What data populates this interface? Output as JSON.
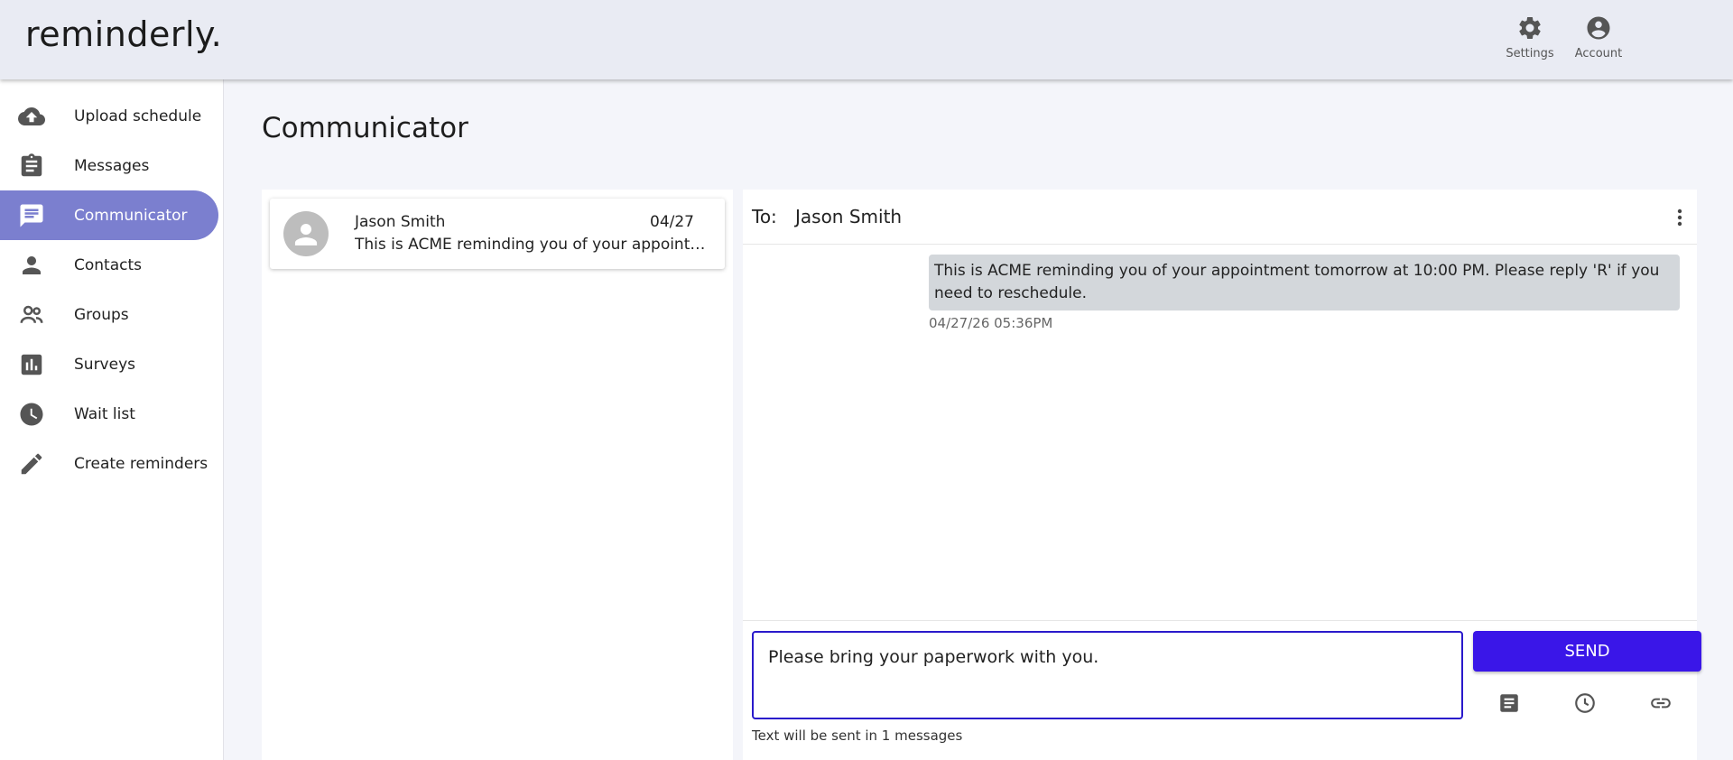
{
  "app": {
    "logo": "reminderly."
  },
  "header": {
    "settings_label": "Settings",
    "account_label": "Account"
  },
  "sidebar": {
    "items": [
      {
        "label": "Upload schedule",
        "icon": "cloud-upload-icon"
      },
      {
        "label": "Messages",
        "icon": "clipboard-icon"
      },
      {
        "label": "Communicator",
        "icon": "chat-icon",
        "active": true
      },
      {
        "label": "Contacts",
        "icon": "person-icon"
      },
      {
        "label": "Groups",
        "icon": "people-icon"
      },
      {
        "label": "Surveys",
        "icon": "bar-chart-icon"
      },
      {
        "label": "Wait list",
        "icon": "clock-icon"
      },
      {
        "label": "Create reminders",
        "icon": "pencil-icon"
      }
    ]
  },
  "page": {
    "title": "Communicator"
  },
  "conversations": [
    {
      "name": "Jason Smith",
      "date": "04/27",
      "preview": "This is ACME reminding you of your appointment tomorrow at 10:00 PM. Please reply 'R' if you need to reschedule."
    }
  ],
  "thread": {
    "to_label": "To:",
    "to_name": "Jason Smith",
    "messages": [
      {
        "text": "This is ACME reminding you of your appointment tomorrow at 10:00 PM. Please reply 'R' if you need to reschedule.",
        "timestamp": "04/27/26 05:36PM"
      }
    ]
  },
  "compose": {
    "value": "Please bring your paperwork with you.",
    "send_label": "SEND",
    "note": "Text will be sent in 1 messages"
  },
  "colors": {
    "accent": "#3a16e8",
    "nav_active": "#7b7fcf",
    "header_bg": "#e9ebf3",
    "bubble_bg": "#d3d7db"
  }
}
